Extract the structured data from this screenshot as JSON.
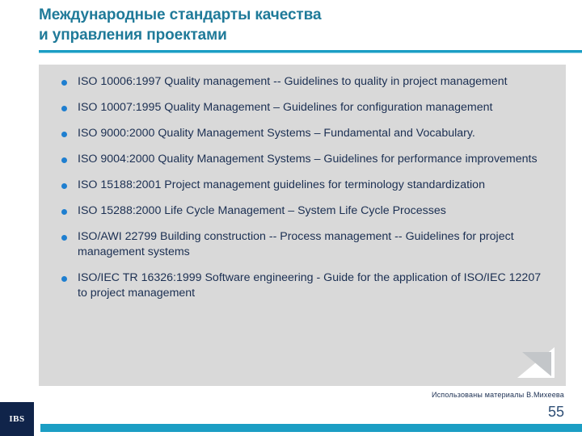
{
  "slide": {
    "title_lines": [
      "Международные стандарты качества",
      "и управления проектами"
    ],
    "bullets": [
      "ISO 10006:1997 Quality management -- Guidelines to quality in project management",
      "ISO 10007:1995 Quality Management – Guidelines for configuration management",
      "ISO 9000:2000 Quality Management Systems – Fundamental and Vocabulary.",
      "ISO 9004:2000 Quality Management Systems – Guidelines for performance improvements",
      "ISO 15188:2001 Project management guidelines for terminology standardization",
      "ISO 15288:2000 Life Cycle Management – System Life Cycle Processes",
      "ISO/AWI 22799 Building construction -- Process management -- Guidelines for project management systems",
      "ISO/IEC TR 16326:1999 Software engineering - Guide for the application of ISO/IEC 12207 to project management"
    ],
    "credit": "Использованы материалы В.Михеева",
    "page_number": "55",
    "logo_text": "IBS",
    "colors": {
      "title": "#1f7a99",
      "rule": "#1b9ec4",
      "panel": "#d9d9d9",
      "bullet_dot": "#1f7fd0",
      "body_text": "#1b2f52",
      "logo_bg": "#10244a",
      "footer_bar": "#1b9ec4"
    }
  }
}
